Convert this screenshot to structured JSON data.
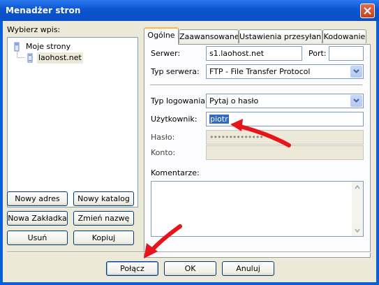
{
  "window": {
    "title": "Menadżer stron"
  },
  "sidebar": {
    "label": "Wybierz wpis:",
    "tree": [
      {
        "label": "Moje strony",
        "icon": "folder-icon"
      },
      {
        "label": "laohost.net",
        "icon": "server-icon"
      }
    ],
    "buttons": {
      "new_address": "Nowy adres",
      "new_folder": "Nowy katalog",
      "new_bookmark": "Nowa Zakładka",
      "rename": "Zmień nazwę",
      "delete": "Usuń",
      "copy": "Kopiuj"
    }
  },
  "tabs": [
    "Ogólne",
    "Zaawansowane",
    "Ustawienia przesyłania",
    "Kodowanie"
  ],
  "general": {
    "server_label": "Serwer:",
    "server_value": "s1.laohost.net",
    "port_label": "Port:",
    "port_value": "",
    "server_type_label": "Typ serwera:",
    "server_type_value": "FTP - File Transfer Protocol",
    "login_type_label": "Typ logowania:",
    "login_type_value": "Pytaj o hasło",
    "user_label": "Użytkownik:",
    "user_value": "piotr",
    "password_label": "Hasło:",
    "password_value": "••••••••••••••",
    "account_label": "Konto:",
    "account_value": "",
    "comments_label": "Komentarze:"
  },
  "footer": {
    "connect": "Połącz",
    "ok": "OK",
    "cancel": "Anuluj"
  },
  "colors": {
    "titlebar": "#0a54d0",
    "dialog_bg": "#ece9d8",
    "annotation_arrow": "#e8141c",
    "selection": "#316ac5"
  }
}
